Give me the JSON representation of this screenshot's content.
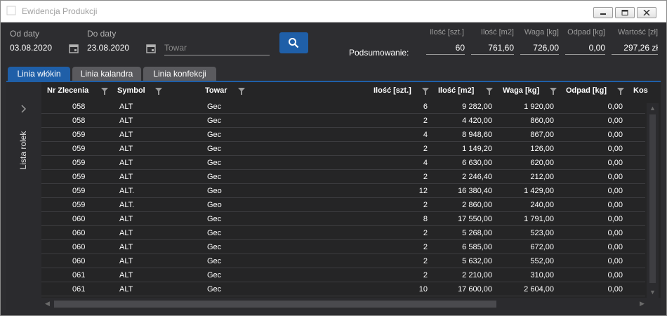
{
  "window": {
    "title": "Ewidencja Produkcji"
  },
  "filters": {
    "from_label": "Od daty",
    "from_value": "03.08.2020",
    "to_label": "Do daty",
    "to_value": "23.08.2020",
    "product_placeholder": "Towar"
  },
  "summary": {
    "label": "Podsumowanie:",
    "headers": [
      "Ilość [szt.]",
      "Ilość [m2]",
      "Waga [kg]",
      "Odpad [kg]",
      "Wartość [zł]"
    ],
    "values": [
      "60",
      "761,60",
      "726,00",
      "0,00",
      "297,26 zł"
    ]
  },
  "tabs": [
    "Linia włókin",
    "Linia kalandra",
    "Linia konfekcji"
  ],
  "side_panel": {
    "label": "Lista rolek"
  },
  "grid": {
    "columns": [
      "Nr Zlecenia",
      "Symbol",
      "Towar",
      "Ilość [szt.]",
      "Ilość [m2]",
      "Waga [kg]",
      "Odpad [kg]",
      "Kos"
    ],
    "rows": [
      [
        "058",
        "ALT",
        "Gec",
        "6",
        "9 282,00",
        "1 920,00",
        "0,00"
      ],
      [
        "058",
        "ALT",
        "Gec",
        "2",
        "4 420,00",
        "860,00",
        "0,00"
      ],
      [
        "059",
        "ALT",
        "Gec",
        "4",
        "8 948,60",
        "867,00",
        "0,00"
      ],
      [
        "059",
        "ALT",
        "Gec",
        "2",
        "1 149,20",
        "126,00",
        "0,00"
      ],
      [
        "059",
        "ALT",
        "Gec",
        "4",
        "6 630,00",
        "620,00",
        "0,00"
      ],
      [
        "059",
        "ALT",
        "Gec",
        "2",
        "2 246,40",
        "212,00",
        "0,00"
      ],
      [
        "059",
        "ALT.",
        "Geo",
        "12",
        "16 380,40",
        "1 429,00",
        "0,00"
      ],
      [
        "059",
        "ALT.",
        "Geo",
        "2",
        "2 860,00",
        "240,00",
        "0,00"
      ],
      [
        "060",
        "ALT",
        "Gec",
        "8",
        "17 550,00",
        "1 791,00",
        "0,00"
      ],
      [
        "060",
        "ALT",
        "Gec",
        "2",
        "5 268,00",
        "523,00",
        "0,00"
      ],
      [
        "060",
        "ALT",
        "Gec",
        "2",
        "6 585,00",
        "672,00",
        "0,00"
      ],
      [
        "060",
        "ALT",
        "Gec",
        "2",
        "5 632,00",
        "552,00",
        "0,00"
      ],
      [
        "061",
        "ALT",
        "Gec",
        "2",
        "2 210,00",
        "310,00",
        "0,00"
      ],
      [
        "061",
        "ALT",
        "Gec",
        "10",
        "17 600,00",
        "2 604,00",
        "0,00"
      ]
    ]
  },
  "colors": {
    "accent": "#1f5fa8",
    "background": "#2d2d30",
    "grid": "#252526"
  },
  "icons": {
    "search": "search-icon",
    "calendar": "calendar-icon",
    "filter": "filter-icon",
    "expand": "chevron-right-icon"
  }
}
